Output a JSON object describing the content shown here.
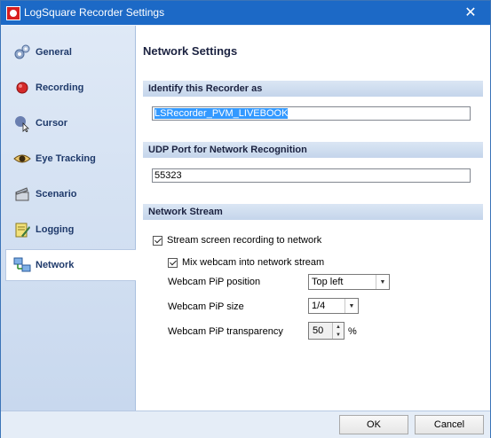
{
  "window": {
    "title": "LogSquare Recorder Settings",
    "close_glyph": "✕"
  },
  "sidebar": {
    "items": [
      {
        "label": "General",
        "icon": "gears-icon"
      },
      {
        "label": "Recording",
        "icon": "record-dot-icon"
      },
      {
        "label": "Cursor",
        "icon": "cursor-icon"
      },
      {
        "label": "Eye Tracking",
        "icon": "eye-icon"
      },
      {
        "label": "Scenario",
        "icon": "clapperboard-icon"
      },
      {
        "label": "Logging",
        "icon": "notepad-pencil-icon"
      },
      {
        "label": "Network",
        "icon": "network-computers-icon",
        "active": true
      }
    ]
  },
  "content": {
    "title": "Network Settings",
    "identify_section": "Identify this Recorder as",
    "recorder_name": "LSRecorder_PVM_LIVEBOOK",
    "udp_section": "UDP Port for Network Recognition",
    "udp_port": "55323",
    "stream_section": "Network Stream",
    "stream_checkbox_label": "Stream screen recording to network",
    "stream_checked": true,
    "webcam_checkbox_label": "Mix webcam into network stream",
    "webcam_checked": true,
    "pip_position_label": "Webcam PiP position",
    "pip_position_value": "Top left",
    "pip_size_label": "Webcam PiP size",
    "pip_size_value": "1/4",
    "pip_transparency_label": "Webcam PiP transparency",
    "pip_transparency_value": "50",
    "pip_transparency_unit": "%"
  },
  "footer": {
    "ok_label": "OK",
    "cancel_label": "Cancel"
  },
  "colors": {
    "titlebar": "#1c69c6",
    "section_header": "#c4d5eb",
    "selection": "#3399ff"
  }
}
